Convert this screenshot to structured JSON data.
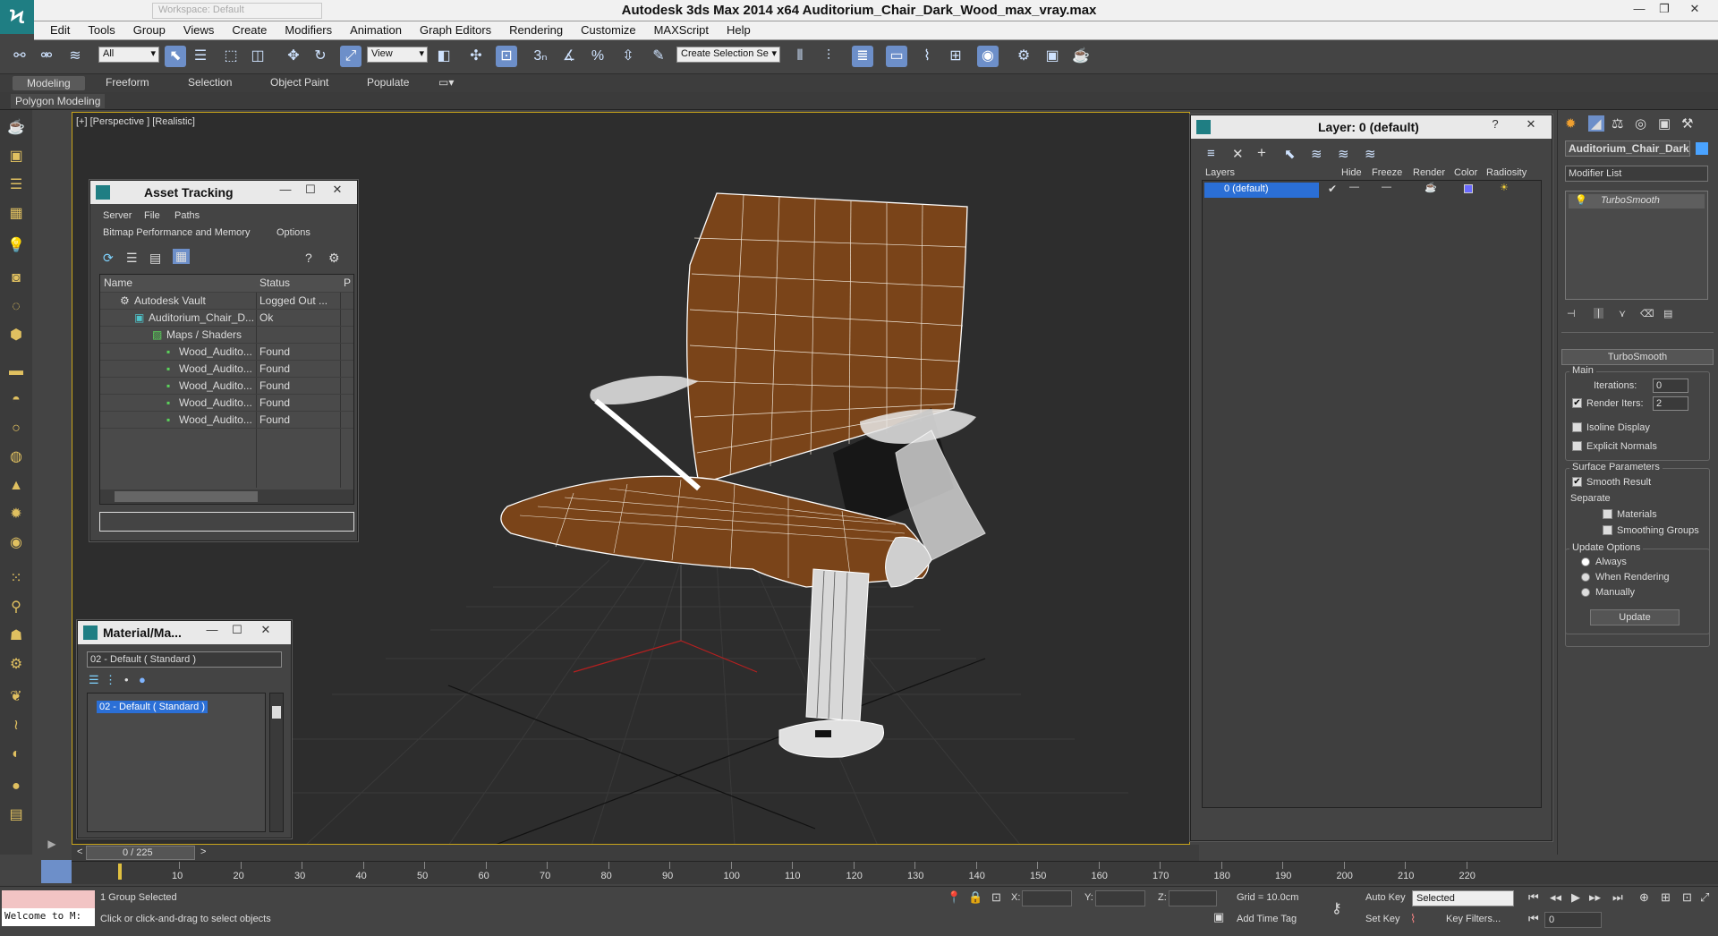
{
  "window": {
    "title": "Autodesk 3ds Max  2014 x64     Auditorium_Chair_Dark_Wood_max_vray.max",
    "quick_access": "Workspace: Default",
    "min": "—",
    "max": "❐",
    "close": "✕"
  },
  "menu": [
    "Edit",
    "Tools",
    "Group",
    "Views",
    "Create",
    "Modifiers",
    "Animation",
    "Graph Editors",
    "Rendering",
    "Customize",
    "MAXScript",
    "Help"
  ],
  "toolbar": {
    "selection_filter": "All",
    "ref_coord": "View",
    "named_selection": "Create Selection Se"
  },
  "ribbon": {
    "tabs": [
      "Modeling",
      "Freeform",
      "Selection",
      "Object Paint",
      "Populate"
    ],
    "panel": "Polygon Modeling"
  },
  "viewport": {
    "label": "[+] [Perspective ] [Realistic]"
  },
  "asset_tracking": {
    "title": "Asset Tracking",
    "menus": [
      "Server",
      "File",
      "Paths",
      "Bitmap Performance and Memory",
      "Options"
    ],
    "columns": [
      "Name",
      "Status",
      "P"
    ],
    "rows": [
      {
        "name": "Autodesk Vault",
        "status": "Logged Out ..."
      },
      {
        "name": "Auditorium_Chair_D...",
        "status": "Ok"
      },
      {
        "name": "Maps / Shaders",
        "status": ""
      },
      {
        "name": "Wood_Audito...",
        "status": "Found"
      },
      {
        "name": "Wood_Audito...",
        "status": "Found"
      },
      {
        "name": "Wood_Audito...",
        "status": "Found"
      },
      {
        "name": "Wood_Audito...",
        "status": "Found"
      },
      {
        "name": "Wood_Audito...",
        "status": "Found"
      }
    ]
  },
  "material_browser": {
    "title": "Material/Ma...",
    "field": "02 - Default ( Standard )",
    "item": "02 - Default ( Standard )"
  },
  "layer_manager": {
    "title": "Layer: 0 (default)",
    "help": "?",
    "columns": [
      "Layers",
      "Hide",
      "Freeze",
      "Render",
      "Color",
      "Radiosity"
    ],
    "layer": "0 (default)"
  },
  "command_panel": {
    "object_name": "Auditorium_Chair_Dark_",
    "modifier_list": "Modifier List",
    "stack_item": "TurboSmooth",
    "rollout": "TurboSmooth",
    "main": "Main",
    "iterations_label": "Iterations:",
    "iterations": "0",
    "render_iters_label": "Render Iters:",
    "render_iters": "2",
    "isoline": "Isoline Display",
    "explicit_normals": "Explicit Normals",
    "surface_params": "Surface Parameters",
    "smooth_result": "Smooth Result",
    "separate": "Separate",
    "materials": "Materials",
    "smoothing_groups": "Smoothing Groups",
    "update_options": "Update Options",
    "always": "Always",
    "when_rendering": "When Rendering",
    "manually": "Manually",
    "update": "Update"
  },
  "timeline": {
    "frame": "0 / 225",
    "ticks": [
      "10",
      "20",
      "30",
      "40",
      "50",
      "60",
      "70",
      "80",
      "90",
      "100",
      "110",
      "120",
      "130",
      "140",
      "150",
      "160",
      "170",
      "180",
      "190",
      "200",
      "210",
      "220"
    ]
  },
  "status": {
    "listener": "Welcome to M:",
    "selection": "1 Group Selected",
    "prompt": "Click or click-and-drag to select objects",
    "x_label": "X:",
    "y_label": "Y:",
    "z_label": "Z:",
    "grid": "Grid = 10.0cm",
    "add_time_tag": "Add Time Tag",
    "auto_key": "Auto Key",
    "set_key": "Set Key",
    "key_mode": "Selected",
    "key_filters": "Key Filters...",
    "frame_field": "0"
  },
  "colors": {
    "wood": "#7a4419",
    "selection_blue": "#2b6fd6",
    "viewport_border": "#c9a41a",
    "brand_teal": "#1f7e83"
  }
}
